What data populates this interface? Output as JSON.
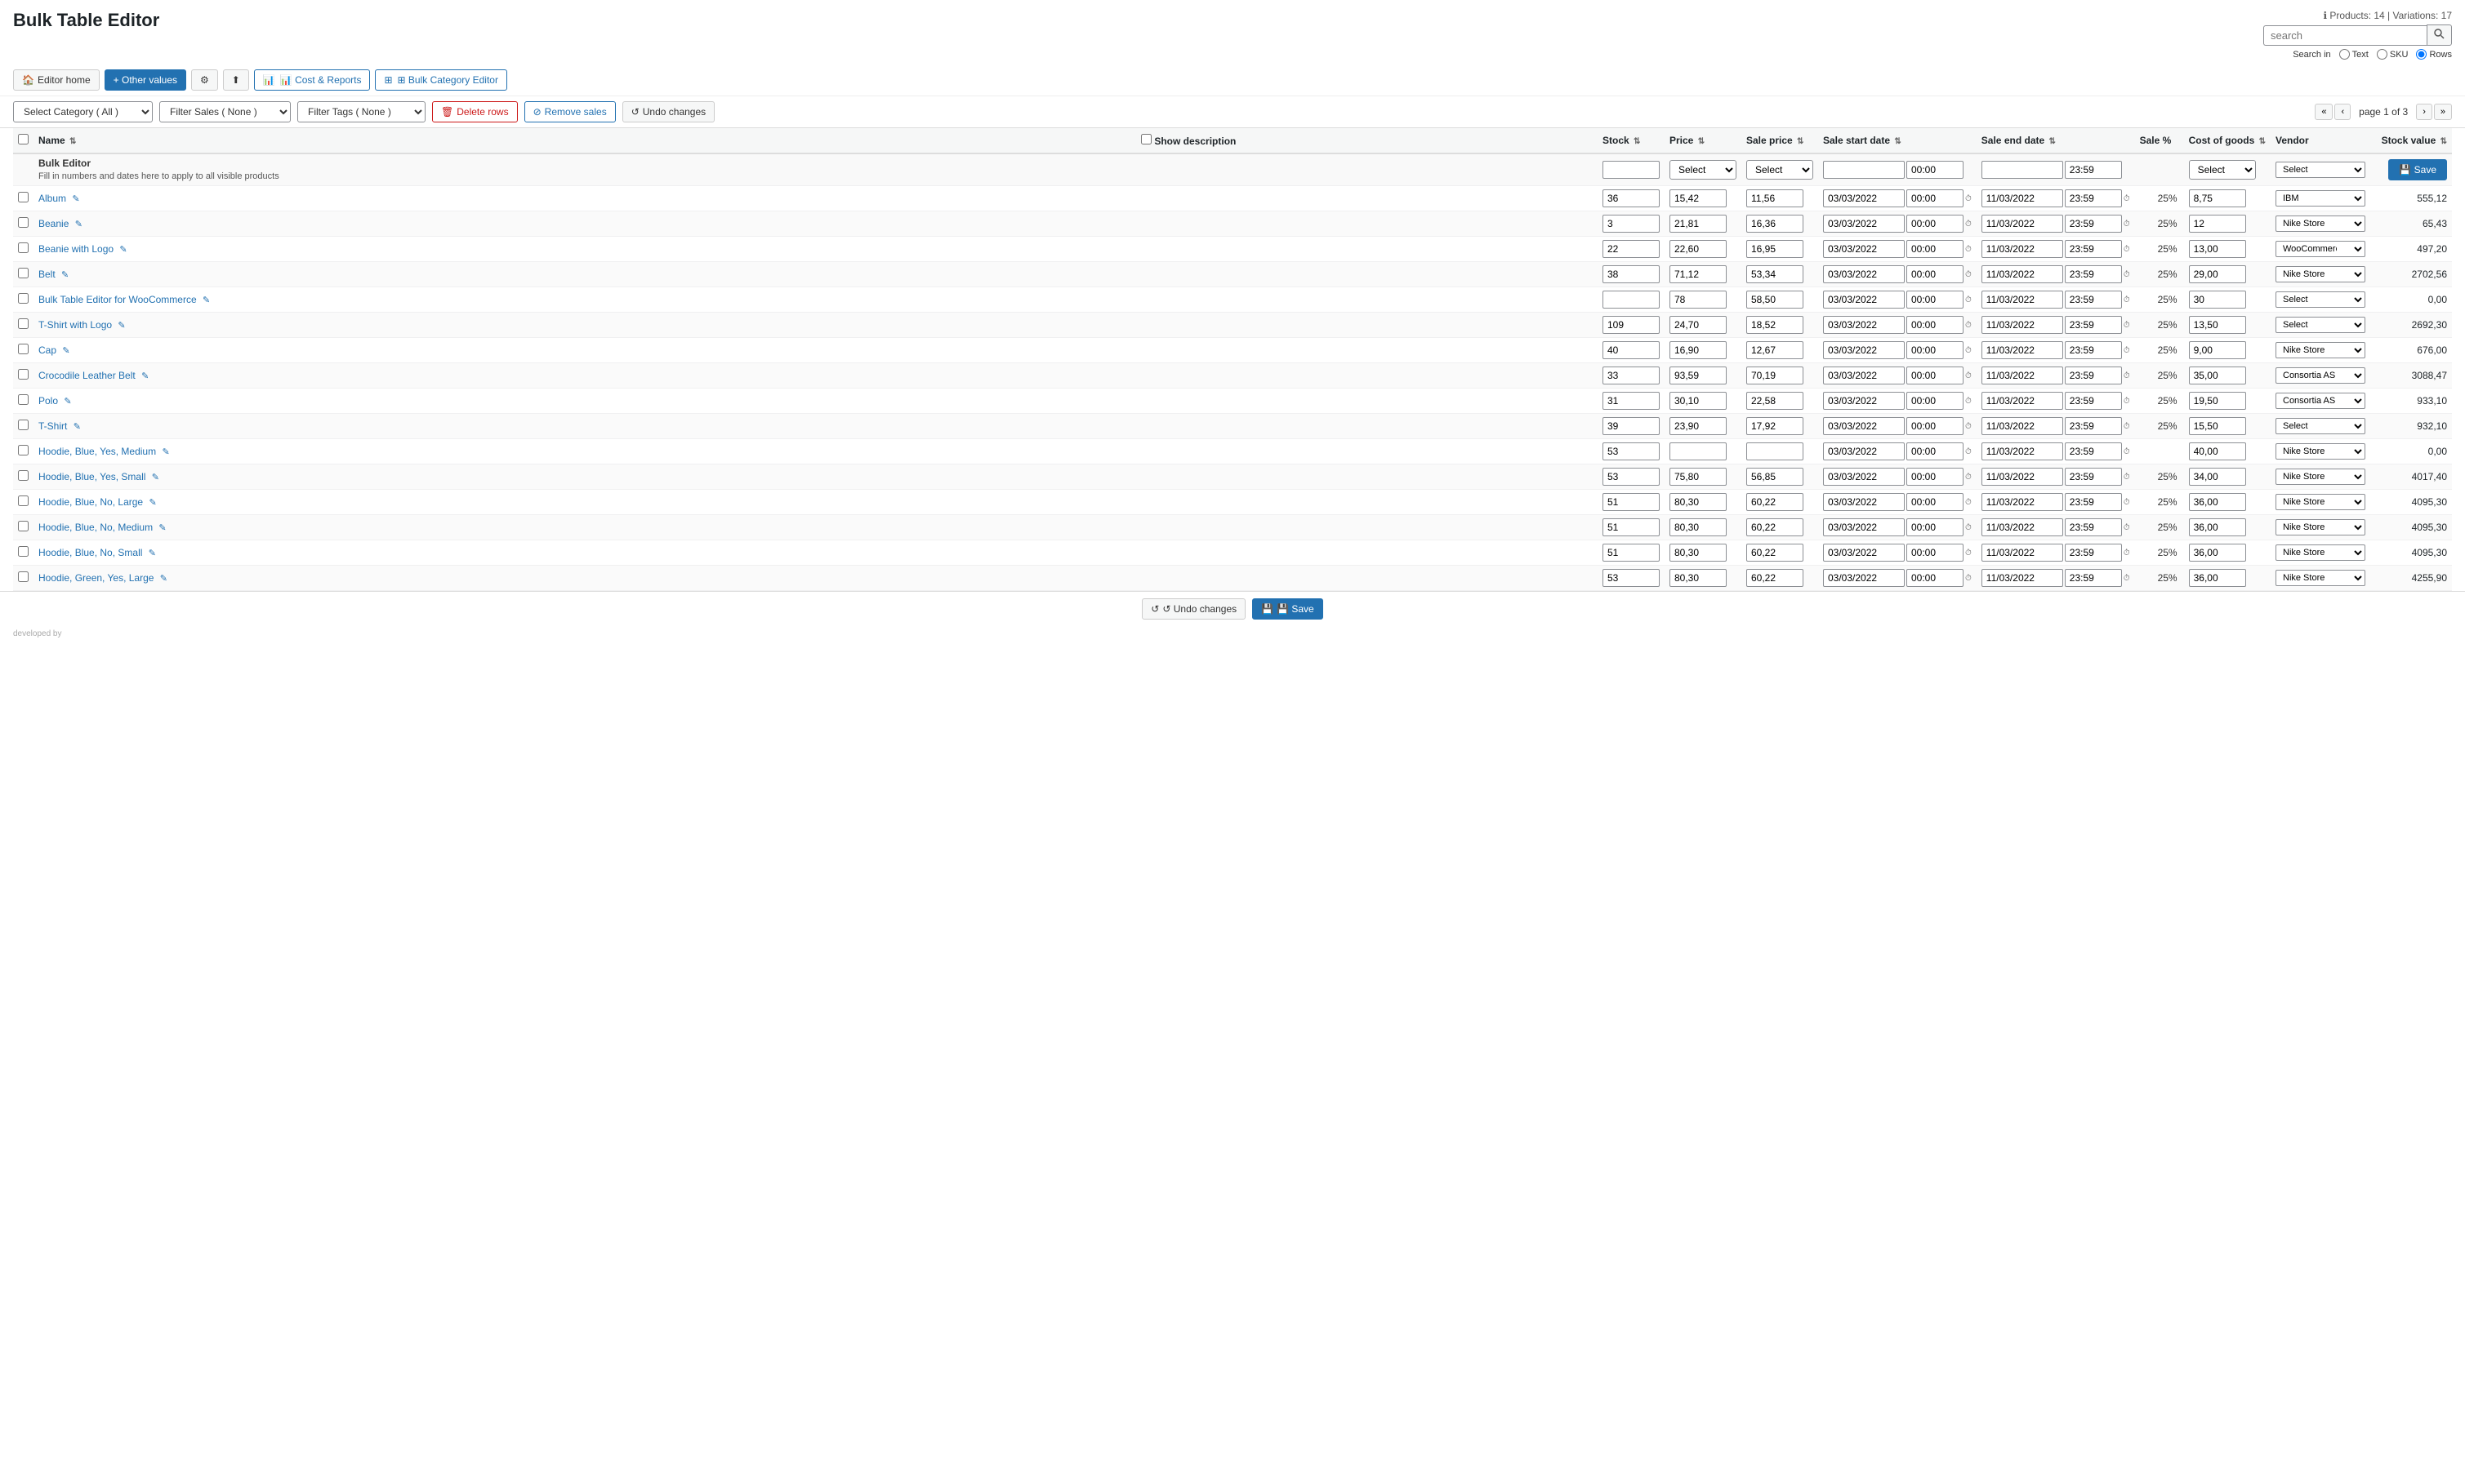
{
  "page": {
    "title": "Bulk Table Editor",
    "products_info": "ℹ Products: 14 | Variations: 17"
  },
  "toolbar": {
    "editor_home": "Editor home",
    "other_values": "+ Other values",
    "settings": "⚙",
    "upload": "⬆",
    "cost_reports": "📊 Cost & Reports",
    "bulk_category_editor": "⊞ Bulk Category Editor"
  },
  "search": {
    "placeholder": "search",
    "label": "Search in",
    "option_text": "Text",
    "option_sku": "SKU",
    "option_rows": "Rows",
    "selected": "Rows"
  },
  "filters": {
    "category_label": "Select Category ( All )",
    "sales_label": "Filter Sales ( None )",
    "tags_label": "Filter Tags ( None )",
    "delete_rows": "Delete rows",
    "remove_sales": "Remove sales",
    "undo_changes": "Undo changes"
  },
  "pagination": {
    "page_info": "page 1 of 3",
    "first": "«",
    "prev": "‹",
    "next": "›",
    "last": "»"
  },
  "table": {
    "headers": {
      "name": "Name",
      "show_description": "Show description",
      "stock": "Stock",
      "price": "Price",
      "sale_price": "Sale price",
      "sale_start": "Sale start date",
      "sale_end": "Sale end date",
      "sale_pct": "Sale %",
      "cost_of_goods": "Cost of goods",
      "vendor": "Vendor",
      "stock_value": "Stock value"
    },
    "bulk_editor": {
      "label": "Bulk Editor",
      "description": "Fill in numbers and dates here to apply to all visible products",
      "time_start": "00:00",
      "time_end": "23:59",
      "save_label": "Save"
    },
    "rows": [
      {
        "name": "Album",
        "stock": "36",
        "price": "15,42",
        "sale_price": "11,56",
        "sale_start_date": "03/03/2022",
        "sale_start_time": "00:00",
        "sale_end_date": "11/03/2022",
        "sale_end_time": "23:59",
        "sale_pct": "25%",
        "cost": "8,75",
        "vendor": "IBM",
        "stock_value": "555,12"
      },
      {
        "name": "Beanie",
        "stock": "3",
        "price": "21,81",
        "sale_price": "16,36",
        "sale_start_date": "03/03/2022",
        "sale_start_time": "00:00",
        "sale_end_date": "11/03/2022",
        "sale_end_time": "23:59",
        "sale_pct": "25%",
        "cost": "12",
        "vendor": "Nike Store",
        "stock_value": "65,43"
      },
      {
        "name": "Beanie with Logo",
        "stock": "22",
        "price": "22,60",
        "sale_price": "16,95",
        "sale_start_date": "03/03/2022",
        "sale_start_time": "00:00",
        "sale_end_date": "11/03/2022",
        "sale_end_time": "23:59",
        "sale_pct": "25%",
        "cost": "13,00",
        "vendor": "WooComme",
        "stock_value": "497,20"
      },
      {
        "name": "Belt",
        "stock": "38",
        "price": "71,12",
        "sale_price": "53,34",
        "sale_start_date": "03/03/2022",
        "sale_start_time": "00:00",
        "sale_end_date": "11/03/2022",
        "sale_end_time": "23:59",
        "sale_pct": "25%",
        "cost": "29,00",
        "vendor": "Nike Store",
        "stock_value": "2702,56"
      },
      {
        "name": "Bulk Table Editor for WooCommerce",
        "stock": "",
        "price": "78",
        "sale_price": "58,50",
        "sale_start_date": "03/03/2022",
        "sale_start_time": "00:00",
        "sale_end_date": "11/03/2022",
        "sale_end_time": "23:59",
        "sale_pct": "25%",
        "cost": "30",
        "vendor": "Select",
        "stock_value": "0,00"
      },
      {
        "name": "T-Shirt with Logo",
        "stock": "109",
        "price": "24,70",
        "sale_price": "18,52",
        "sale_start_date": "03/03/2022",
        "sale_start_time": "00:00",
        "sale_end_date": "11/03/2022",
        "sale_end_time": "23:59",
        "sale_pct": "25%",
        "cost": "13,50",
        "vendor": "Select",
        "stock_value": "2692,30"
      },
      {
        "name": "Cap",
        "stock": "40",
        "price": "16,90",
        "sale_price": "12,67",
        "sale_start_date": "03/03/2022",
        "sale_start_time": "00:00",
        "sale_end_date": "11/03/2022",
        "sale_end_time": "23:59",
        "sale_pct": "25%",
        "cost": "9,00",
        "vendor": "Nike Store",
        "stock_value": "676,00"
      },
      {
        "name": "Crocodile Leather Belt",
        "stock": "33",
        "price": "93,59",
        "sale_price": "70,19",
        "sale_start_date": "03/03/2022",
        "sale_start_time": "00:00",
        "sale_end_date": "11/03/2022",
        "sale_end_time": "23:59",
        "sale_pct": "25%",
        "cost": "35,00",
        "vendor": "Consortia AS",
        "stock_value": "3088,47"
      },
      {
        "name": "Polo",
        "stock": "31",
        "price": "30,10",
        "sale_price": "22,58",
        "sale_start_date": "03/03/2022",
        "sale_start_time": "00:00",
        "sale_end_date": "11/03/2022",
        "sale_end_time": "23:59",
        "sale_pct": "25%",
        "cost": "19,50",
        "vendor": "Consortia AS",
        "stock_value": "933,10"
      },
      {
        "name": "T-Shirt",
        "stock": "39",
        "price": "23,90",
        "sale_price": "17,92",
        "sale_start_date": "03/03/2022",
        "sale_start_time": "00:00",
        "sale_end_date": "11/03/2022",
        "sale_end_time": "23:59",
        "sale_pct": "25%",
        "cost": "15,50",
        "vendor": "Select",
        "stock_value": "932,10"
      },
      {
        "name": "Hoodie, Blue, Yes, Medium",
        "stock": "53",
        "price": "",
        "sale_price": "",
        "sale_start_date": "03/03/2022",
        "sale_start_time": "00:00",
        "sale_end_date": "11/03/2022",
        "sale_end_time": "23:59",
        "sale_pct": "",
        "cost": "40,00",
        "vendor": "Nike Store",
        "stock_value": "0,00"
      },
      {
        "name": "Hoodie, Blue, Yes, Small",
        "stock": "53",
        "price": "75,80",
        "sale_price": "56,85",
        "sale_start_date": "03/03/2022",
        "sale_start_time": "00:00",
        "sale_end_date": "11/03/2022",
        "sale_end_time": "23:59",
        "sale_pct": "25%",
        "cost": "34,00",
        "vendor": "Nike Store",
        "stock_value": "4017,40"
      },
      {
        "name": "Hoodie, Blue, No, Large",
        "stock": "51",
        "price": "80,30",
        "sale_price": "60,22",
        "sale_start_date": "03/03/2022",
        "sale_start_time": "00:00",
        "sale_end_date": "11/03/2022",
        "sale_end_time": "23:59",
        "sale_pct": "25%",
        "cost": "36,00",
        "vendor": "Nike Store",
        "stock_value": "4095,30"
      },
      {
        "name": "Hoodie, Blue, No, Medium",
        "stock": "51",
        "price": "80,30",
        "sale_price": "60,22",
        "sale_start_date": "03/03/2022",
        "sale_start_time": "00:00",
        "sale_end_date": "11/03/2022",
        "sale_end_time": "23:59",
        "sale_pct": "25%",
        "cost": "36,00",
        "vendor": "Nike Store",
        "stock_value": "4095,30"
      },
      {
        "name": "Hoodie, Blue, No, Small",
        "stock": "51",
        "price": "80,30",
        "sale_price": "60,22",
        "sale_start_date": "03/03/2022",
        "sale_start_time": "00:00",
        "sale_end_date": "11/03/2022",
        "sale_end_time": "23:59",
        "sale_pct": "25%",
        "cost": "36,00",
        "vendor": "Nike Store",
        "stock_value": "4095,30"
      },
      {
        "name": "Hoodie, Green, Yes, Large",
        "stock": "53",
        "price": "80,30",
        "sale_price": "60,22",
        "sale_start_date": "03/03/2022",
        "sale_start_time": "00:00",
        "sale_end_date": "11/03/2022",
        "sale_end_time": "23:59",
        "sale_pct": "25%",
        "cost": "36,00",
        "vendor": "Nike Store",
        "stock_value": "4255,90"
      }
    ]
  },
  "bottom_bar": {
    "undo_label": "↺ Undo changes",
    "save_label": "💾 Save"
  },
  "developed_by": "developed by"
}
